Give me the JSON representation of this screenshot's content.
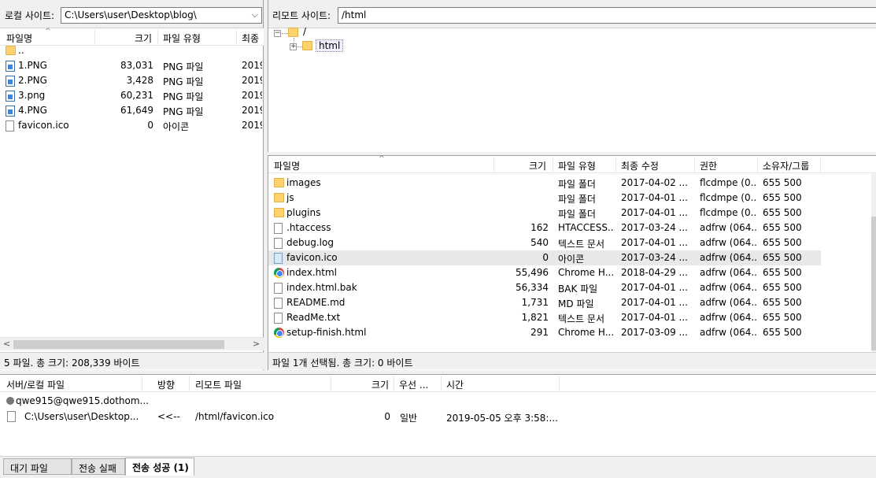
{
  "local": {
    "label": "로컬 사이트:",
    "path": "C:\\Users\\user\\Desktop\\blog\\",
    "columns": [
      "파일명",
      "크기",
      "파일 유형",
      "최종"
    ],
    "rows": [
      {
        "name": "..",
        "size": "",
        "type": "",
        "date": "",
        "icon": "folder"
      },
      {
        "name": "1.PNG",
        "size": "83,031",
        "type": "PNG 파일",
        "date": "2019",
        "icon": "png"
      },
      {
        "name": "2.PNG",
        "size": "3,428",
        "type": "PNG 파일",
        "date": "2019",
        "icon": "png"
      },
      {
        "name": "3.png",
        "size": "60,231",
        "type": "PNG 파일",
        "date": "2019",
        "icon": "png"
      },
      {
        "name": "4.PNG",
        "size": "61,649",
        "type": "PNG 파일",
        "date": "2019",
        "icon": "png"
      },
      {
        "name": "favicon.ico",
        "size": "0",
        "type": "아이콘",
        "date": "2019",
        "icon": "file"
      }
    ],
    "status": "5 파일. 총 크기: 208,339 바이트"
  },
  "remote": {
    "label": "리모트 사이트:",
    "path": "/html",
    "tree": {
      "root": "/",
      "child": "html"
    },
    "columns": [
      "파일명",
      "크기",
      "파일 유형",
      "최종 수정",
      "권한",
      "소유자/그룹"
    ],
    "rows": [
      {
        "name": "images",
        "size": "",
        "type": "파일 폴더",
        "date": "2017-04-02 ...",
        "perm": "flcdmpe (0...",
        "owner": "655 500",
        "icon": "folder"
      },
      {
        "name": "js",
        "size": "",
        "type": "파일 폴더",
        "date": "2017-04-01 ...",
        "perm": "flcdmpe (0...",
        "owner": "655 500",
        "icon": "folder"
      },
      {
        "name": "plugins",
        "size": "",
        "type": "파일 폴더",
        "date": "2017-04-01 ...",
        "perm": "flcdmpe (0...",
        "owner": "655 500",
        "icon": "folder"
      },
      {
        "name": ".htaccess",
        "size": "162",
        "type": "HTACCESS...",
        "date": "2017-03-24 ...",
        "perm": "adfrw (064...",
        "owner": "655 500",
        "icon": "file"
      },
      {
        "name": "debug.log",
        "size": "540",
        "type": "텍스트 문서",
        "date": "2017-04-01 ...",
        "perm": "adfrw (064...",
        "owner": "655 500",
        "icon": "file"
      },
      {
        "name": "favicon.ico",
        "size": "0",
        "type": "아이콘",
        "date": "2017-03-24 ...",
        "perm": "adfrw (064...",
        "owner": "655 500",
        "icon": "ico"
      },
      {
        "name": "index.html",
        "size": "55,496",
        "type": "Chrome H...",
        "date": "2018-04-29 ...",
        "perm": "adfrw (064...",
        "owner": "655 500",
        "icon": "chrome"
      },
      {
        "name": "index.html.bak",
        "size": "56,334",
        "type": "BAK 파일",
        "date": "2017-04-01 ...",
        "perm": "adfrw (064...",
        "owner": "655 500",
        "icon": "file"
      },
      {
        "name": "README.md",
        "size": "1,731",
        "type": "MD 파일",
        "date": "2017-04-01 ...",
        "perm": "adfrw (064...",
        "owner": "655 500",
        "icon": "file"
      },
      {
        "name": "ReadMe.txt",
        "size": "1,821",
        "type": "텍스트 문서",
        "date": "2017-04-01 ...",
        "perm": "adfrw (064...",
        "owner": "655 500",
        "icon": "file"
      },
      {
        "name": "setup-finish.html",
        "size": "291",
        "type": "Chrome H...",
        "date": "2017-03-09 ...",
        "perm": "adfrw (064...",
        "owner": "655 500",
        "icon": "chrome"
      }
    ],
    "status": "파일 1개 선택됨. 총 크기: 0 바이트"
  },
  "queue": {
    "columns": [
      "서버/로컬 파일",
      "방향",
      "리모트 파일",
      "크기",
      "우선 ...",
      "시간"
    ],
    "server": "qwe915@qwe915.dothom...",
    "item": {
      "local": "C:\\Users\\user\\Desktop...",
      "dir": "<<--",
      "remote": "/html/favicon.ico",
      "size": "0",
      "priority": "일반",
      "time": "2019-05-05 오후 3:58:..."
    }
  },
  "tabs": [
    "대기 파일",
    "전송 실패",
    "전송 성공 (1)"
  ]
}
